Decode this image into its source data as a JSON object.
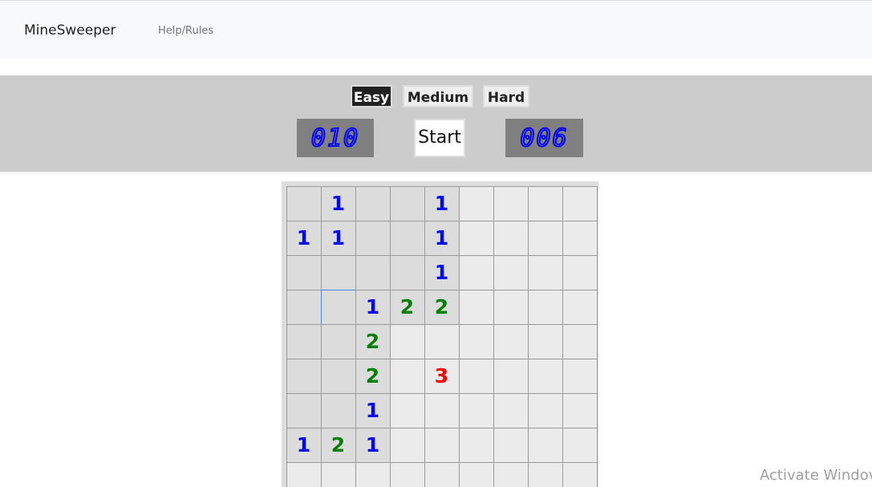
{
  "nav": {
    "brand": "MineSweeper",
    "help_link": "Help/Rules"
  },
  "difficulty": {
    "easy_label": "Easy",
    "medium_label": "Medium",
    "hard_label": "Hard",
    "selected": "Easy"
  },
  "controls": {
    "mine_counter": "010",
    "start_label": "Start",
    "timer": "006"
  },
  "board": {
    "rows": [
      [
        {
          "s": "open",
          "v": ""
        },
        {
          "s": "open",
          "v": "1"
        },
        {
          "s": "open",
          "v": ""
        },
        {
          "s": "open",
          "v": ""
        },
        {
          "s": "open",
          "v": "1"
        },
        {
          "s": "closed",
          "v": ""
        },
        {
          "s": "closed",
          "v": ""
        },
        {
          "s": "closed",
          "v": ""
        },
        {
          "s": "closed",
          "v": ""
        }
      ],
      [
        {
          "s": "open",
          "v": "1"
        },
        {
          "s": "open",
          "v": "1"
        },
        {
          "s": "open",
          "v": ""
        },
        {
          "s": "open",
          "v": ""
        },
        {
          "s": "open",
          "v": "1"
        },
        {
          "s": "closed",
          "v": ""
        },
        {
          "s": "closed",
          "v": ""
        },
        {
          "s": "closed",
          "v": ""
        },
        {
          "s": "closed",
          "v": ""
        }
      ],
      [
        {
          "s": "open",
          "v": ""
        },
        {
          "s": "open",
          "v": ""
        },
        {
          "s": "open",
          "v": ""
        },
        {
          "s": "open",
          "v": ""
        },
        {
          "s": "open",
          "v": "1"
        },
        {
          "s": "closed",
          "v": ""
        },
        {
          "s": "closed",
          "v": ""
        },
        {
          "s": "closed",
          "v": ""
        },
        {
          "s": "closed",
          "v": ""
        }
      ],
      [
        {
          "s": "open",
          "v": ""
        },
        {
          "s": "selected",
          "v": ""
        },
        {
          "s": "open",
          "v": "1"
        },
        {
          "s": "open",
          "v": "2"
        },
        {
          "s": "open",
          "v": "2"
        },
        {
          "s": "closed",
          "v": ""
        },
        {
          "s": "closed",
          "v": ""
        },
        {
          "s": "closed",
          "v": ""
        },
        {
          "s": "closed",
          "v": ""
        }
      ],
      [
        {
          "s": "open",
          "v": ""
        },
        {
          "s": "open",
          "v": ""
        },
        {
          "s": "open",
          "v": "2"
        },
        {
          "s": "closed",
          "v": ""
        },
        {
          "s": "closed",
          "v": ""
        },
        {
          "s": "closed",
          "v": ""
        },
        {
          "s": "closed",
          "v": ""
        },
        {
          "s": "closed",
          "v": ""
        },
        {
          "s": "closed",
          "v": ""
        }
      ],
      [
        {
          "s": "open",
          "v": ""
        },
        {
          "s": "open",
          "v": ""
        },
        {
          "s": "open",
          "v": "2"
        },
        {
          "s": "closed",
          "v": ""
        },
        {
          "s": "closed",
          "v": "3"
        },
        {
          "s": "closed",
          "v": ""
        },
        {
          "s": "closed",
          "v": ""
        },
        {
          "s": "closed",
          "v": ""
        },
        {
          "s": "closed",
          "v": ""
        }
      ],
      [
        {
          "s": "open",
          "v": ""
        },
        {
          "s": "open",
          "v": ""
        },
        {
          "s": "open",
          "v": "1"
        },
        {
          "s": "closed",
          "v": ""
        },
        {
          "s": "closed",
          "v": ""
        },
        {
          "s": "closed",
          "v": ""
        },
        {
          "s": "closed",
          "v": ""
        },
        {
          "s": "closed",
          "v": ""
        },
        {
          "s": "closed",
          "v": ""
        }
      ],
      [
        {
          "s": "open",
          "v": "1"
        },
        {
          "s": "open",
          "v": "2"
        },
        {
          "s": "open",
          "v": "1"
        },
        {
          "s": "closed",
          "v": ""
        },
        {
          "s": "closed",
          "v": ""
        },
        {
          "s": "closed",
          "v": ""
        },
        {
          "s": "closed",
          "v": ""
        },
        {
          "s": "closed",
          "v": ""
        },
        {
          "s": "closed",
          "v": ""
        }
      ],
      [
        {
          "s": "closed",
          "v": ""
        },
        {
          "s": "closed",
          "v": ""
        },
        {
          "s": "closed",
          "v": ""
        },
        {
          "s": "closed",
          "v": ""
        },
        {
          "s": "closed",
          "v": ""
        },
        {
          "s": "closed",
          "v": ""
        },
        {
          "s": "closed",
          "v": ""
        },
        {
          "s": "closed",
          "v": ""
        },
        {
          "s": "closed",
          "v": ""
        }
      ]
    ],
    "number_colors": {
      "1": "#0000ff",
      "2": "#008000",
      "3": "#ff0000"
    }
  },
  "watermark": "Activate Windov"
}
